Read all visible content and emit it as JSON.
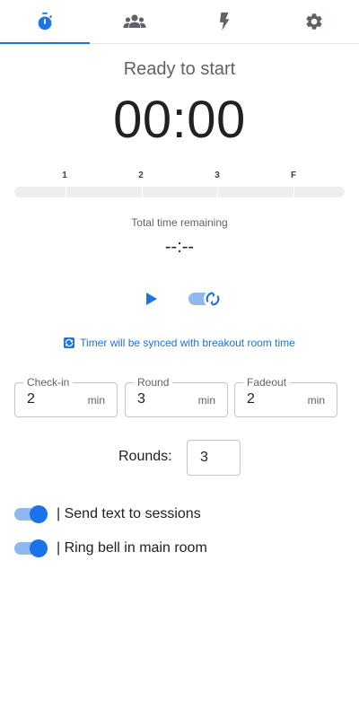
{
  "tabs": [
    {
      "icon": "stopwatch-icon",
      "active": true
    },
    {
      "icon": "groups-icon",
      "active": false
    },
    {
      "icon": "bolt-icon",
      "active": false
    },
    {
      "icon": "gear-icon",
      "active": false
    }
  ],
  "colors": {
    "accent": "#1a73e8",
    "text": "#202124",
    "muted": "#5f6368",
    "track": "#eeeeee"
  },
  "timer": {
    "status": "Ready to start",
    "clock": "00:00",
    "markers": [
      "1",
      "2",
      "3",
      "F"
    ],
    "total_label": "Total time remaining",
    "total_value": "--:--"
  },
  "controls": {
    "play_icon": "play-icon",
    "sync_toggle_icon": "sync-icon",
    "sync_enabled": true
  },
  "sync_note": "Timer will be synced with breakout room time",
  "fields": [
    {
      "label": "Check-in",
      "value": "2",
      "unit": "min"
    },
    {
      "label": "Round",
      "value": "3",
      "unit": "min"
    },
    {
      "label": "Fadeout",
      "value": "2",
      "unit": "min"
    }
  ],
  "rounds": {
    "label": "Rounds:",
    "value": "3"
  },
  "toggles": [
    {
      "label": "| Send text to sessions",
      "on": true
    },
    {
      "label": "| Ring bell in main room",
      "on": true
    }
  ]
}
